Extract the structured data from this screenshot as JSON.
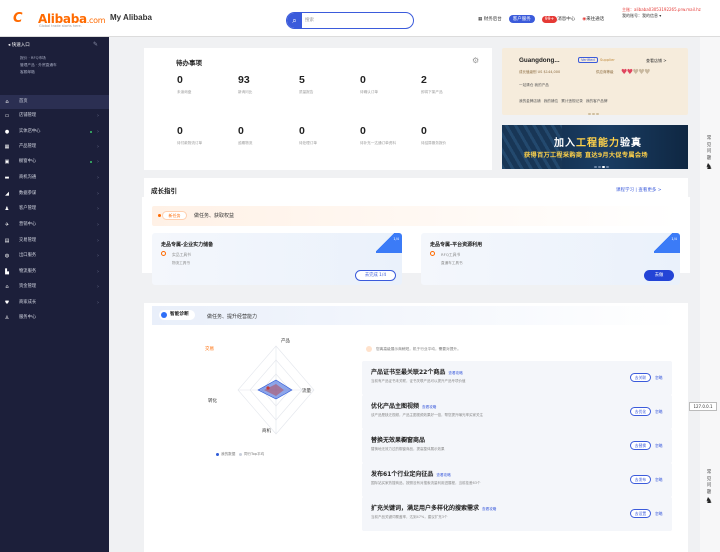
{
  "header": {
    "logo_mark": "C",
    "logo_text": "Alibaba",
    "logo_suffix": ".com",
    "logo_tagline": "Global trade starts here.",
    "my_alibaba": "My Alibaba",
    "search_placeholder": "搜索",
    "links": [
      "财务后台",
      "客户服务",
      "消息中心",
      "来往通话"
    ],
    "user_line1": "主账：alibaba03053192265.prw.mail.hz",
    "user_line2": "我的账号：我的信息 ▾",
    "message_count": "99+"
  },
  "sidebar": {
    "favorites": "快速入口",
    "fav_links": [
      "报价 · RFQ市场",
      "管理产品 · 外贸直通车",
      "客服邮箱"
    ],
    "items": [
      {
        "icon": "home-icon",
        "label": "首页"
      },
      {
        "icon": "store-icon",
        "label": "店铺管理"
      },
      {
        "icon": "star-icon",
        "label": "实体店中心"
      },
      {
        "icon": "grid-icon",
        "label": "产品管理"
      },
      {
        "icon": "bag-icon",
        "label": "橱窗中心"
      },
      {
        "icon": "chat-icon",
        "label": "商机沟通"
      },
      {
        "icon": "chart-icon",
        "label": "数据参谋"
      },
      {
        "icon": "user-icon",
        "label": "客户管理"
      },
      {
        "icon": "flight-icon",
        "label": "营销中心"
      },
      {
        "icon": "doc-icon",
        "label": "交易管理"
      },
      {
        "icon": "globe-icon",
        "label": "出口服务"
      },
      {
        "icon": "truck-icon",
        "label": "物流服务"
      },
      {
        "icon": "bank-icon",
        "label": "资金管理"
      },
      {
        "icon": "heart-icon",
        "label": "商家成长"
      },
      {
        "icon": "person-icon",
        "label": "服务中心"
      }
    ]
  },
  "todo": {
    "title": "待办事项",
    "stats": [
      {
        "n": "0",
        "l": "未读询盘"
      },
      {
        "n": "93",
        "l": "新询问比"
      },
      {
        "n": "5",
        "l": "质量报告"
      },
      {
        "n": "0",
        "l": "待确认订单"
      },
      {
        "n": "2",
        "l": "即将下架产品"
      },
      {
        "n": "0",
        "l": "待付款物流订单"
      },
      {
        "n": "0",
        "l": "逾期物流"
      },
      {
        "n": "0",
        "l": "待处理订单"
      },
      {
        "n": "0",
        "l": "待补充一达通订单资料"
      },
      {
        "n": "0",
        "l": "待结算服务报价"
      }
    ]
  },
  "store": {
    "name": "Guangdong...",
    "verified": "Verified",
    "supplier": "Supplier",
    "view_shop": "查看店铺 >",
    "growth": "成长值级别 US $144,000",
    "rating_label": "供应商等级",
    "link_row1": "一站清仓 我的产品",
    "link_row2": "我的金牌店铺 我的铺位 累计违规记录 我的客户品牌"
  },
  "banner": {
    "line1a": "加入",
    "line1b": "工程能力",
    "line1c": "验真",
    "line2": "获得百万工程采购商 直达9月大促专属会场"
  },
  "growth": {
    "title": "成长指引",
    "links": "课程学习 | 查看更多 >"
  },
  "newtask": {
    "badge": "新任务",
    "subtitle": "做任务、获取权益",
    "cards": [
      {
        "title": "走品专属-企业实力储备",
        "line1": "实品工具书",
        "line2": "物流工具书",
        "corner": "1/4",
        "button": "去完成 1/4"
      },
      {
        "title": "走品专属-平台资源利用",
        "line1": "RFQ工具书",
        "line2": "直通车工具书",
        "corner": "1/4",
        "button": "去做"
      }
    ]
  },
  "diag": {
    "badge": "智能诊断",
    "subtitle": "做任务、提升经营能力",
    "radar": {
      "top": "产品",
      "left": "转化",
      "right": "流量",
      "bottom": "商机",
      "flag": "交易"
    },
    "legend": [
      "我的数据",
      "同行Top平均"
    ],
    "note": "您离高级展示商稍短，机于行业平均，需要对提升。",
    "items": [
      {
        "title": "产品证书至最关联22个商品",
        "tag": "查看攻略",
        "desc": "当前有产品证书未关联，证书关联产品可以提升产品专项价值",
        "button": "去关联",
        "link": "忽略"
      },
      {
        "title": "优化产品主图视频",
        "tag": "查看攻略",
        "desc": "该产品是缺乏视频，产品主图视频效果好一倍，帮您提升曝光率买家关注",
        "button": "去优化",
        "link": "忽略"
      },
      {
        "title": "替换无效果橱窗商品",
        "tag": "",
        "desc": "替换地无效力过的橱窗商品，提高整体展示效果",
        "button": "去替换",
        "link": "忽略"
      },
      {
        "title": "发布61个行业定向征品",
        "tag": "查看攻略",
        "desc": "国际站买家热搜商品，按照没有对搜索流量利用进展程，当前挂差63个",
        "button": "去发布",
        "link": "忽略"
      },
      {
        "title": "扩充关键词，满足用户多样化的搜索需求",
        "tag": "查看攻略",
        "desc": "当前产品关键词覆盖率，达到47%，建议扩充3个",
        "button": "去设置",
        "link": "忽略"
      }
    ]
  },
  "rail": {
    "help": "常见问题",
    "version": "127.0.0.1"
  }
}
